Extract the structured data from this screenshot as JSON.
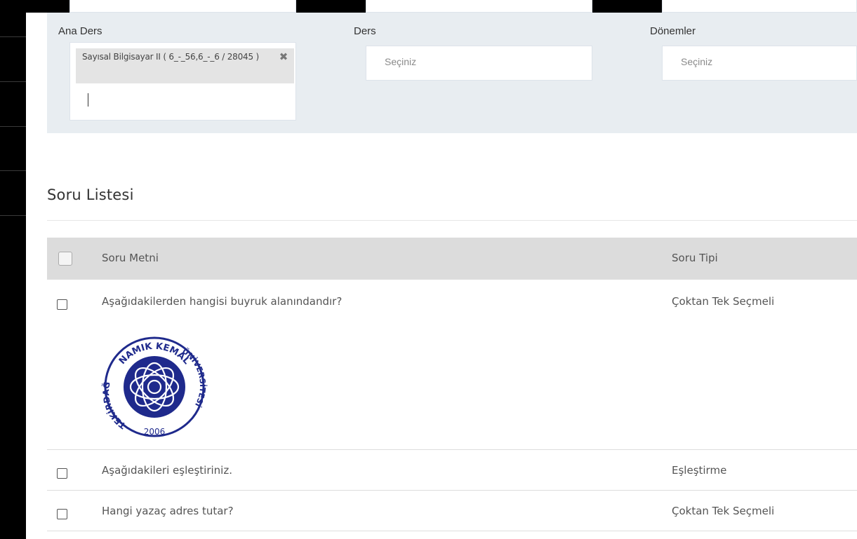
{
  "filters": {
    "ana_ders": {
      "label": "Ana Ders",
      "selected_tag": "Sayısal Bilgisayar II ( 6_-_56,6_-_6 / 28045 )",
      "remove_glyph": "✖"
    },
    "ders": {
      "label": "Ders",
      "placeholder": "Seçiniz"
    },
    "donemler": {
      "label": "Dönemler",
      "placeholder": "Seçiniz"
    }
  },
  "section": {
    "title": "Soru Listesi"
  },
  "table": {
    "headers": {
      "text": "Soru Metni",
      "type": "Soru Tipi"
    },
    "rows": [
      {
        "text": "Aşağıdakilerden hangisi buyruk alanındandır?",
        "type": "Çoktan Tek Seçmeli"
      },
      {
        "text": "Aşağıdakileri eşleştiriniz.",
        "type": "Eşleştirme"
      },
      {
        "text": "Hangi yazaç adres tutar?",
        "type": "Çoktan Tek Seçmeli"
      }
    ]
  },
  "logo": {
    "top_text": "NAMIK KEMAL",
    "left_text": "TEKİRDAĞ",
    "right_text": "ÜNİVERSİTESİ",
    "year": "2006",
    "color": "#1f2a8c"
  }
}
